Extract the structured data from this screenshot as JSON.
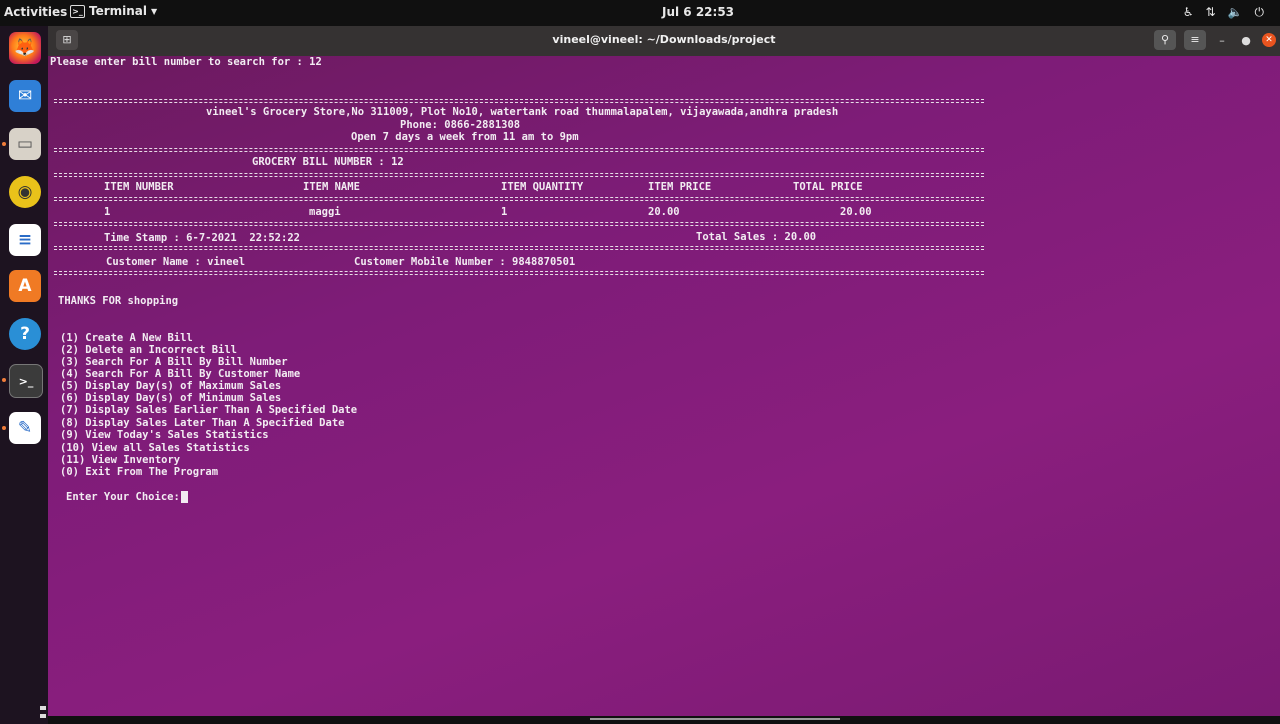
{
  "topbar": {
    "activities": "Activities",
    "app_name": "Terminal",
    "clock": "Jul 6  22:53"
  },
  "dock": {
    "apps": [
      "firefox-icon",
      "thunderbird-icon",
      "files-icon",
      "rhythmbox-icon",
      "libreoffice-writer-icon",
      "software-icon",
      "help-icon",
      "terminal-icon",
      "text-editor-icon"
    ]
  },
  "window": {
    "title": "vineel@vineel: ~/Downloads/project"
  },
  "terminal": {
    "prompt_search": "Please enter bill number to search for : 12",
    "store_line": "vineel's Grocery Store,No 311009, Plot No10, watertank road thummalapalem, vijayawada,andhra pradesh",
    "phone_line": "Phone: 0866-2881308",
    "hours_line": "Open 7 days a week from 11 am to 9pm",
    "bill_number_line": "GROCERY BILL NUMBER : 12",
    "columns": [
      "ITEM NUMBER",
      "ITEM NAME",
      "ITEM QUANTITY",
      "ITEM PRICE",
      "TOTAL PRICE"
    ],
    "row": {
      "item_number": "1",
      "item_name": "maggi",
      "quantity": "1",
      "price": "20.00",
      "total": "20.00"
    },
    "timestamp": "Time Stamp : 6-7-2021  22:52:22",
    "total_sales": "Total Sales : 20.00",
    "customer_name": "Customer Name : vineel",
    "customer_mobile": "Customer Mobile Number : 9848870501",
    "thanks": "THANKS FOR shopping",
    "menu": [
      "(1) Create A New Bill",
      "(2) Delete an Incorrect Bill",
      "(3) Search For A Bill By Bill Number",
      "(4) Search For A Bill By Customer Name",
      "(5) Display Day(s) of Maximum Sales",
      "(6) Display Day(s) of Minimum Sales",
      "(7) Display Sales Earlier Than A Specified Date",
      "(8) Display Sales Later Than A Specified Date",
      "(9) View Today's Sales Statistics",
      "(10) View all Sales Statistics",
      "(11) View Inventory",
      "(0) Exit From The Program"
    ],
    "choice_prompt": "Enter Your Choice:"
  }
}
